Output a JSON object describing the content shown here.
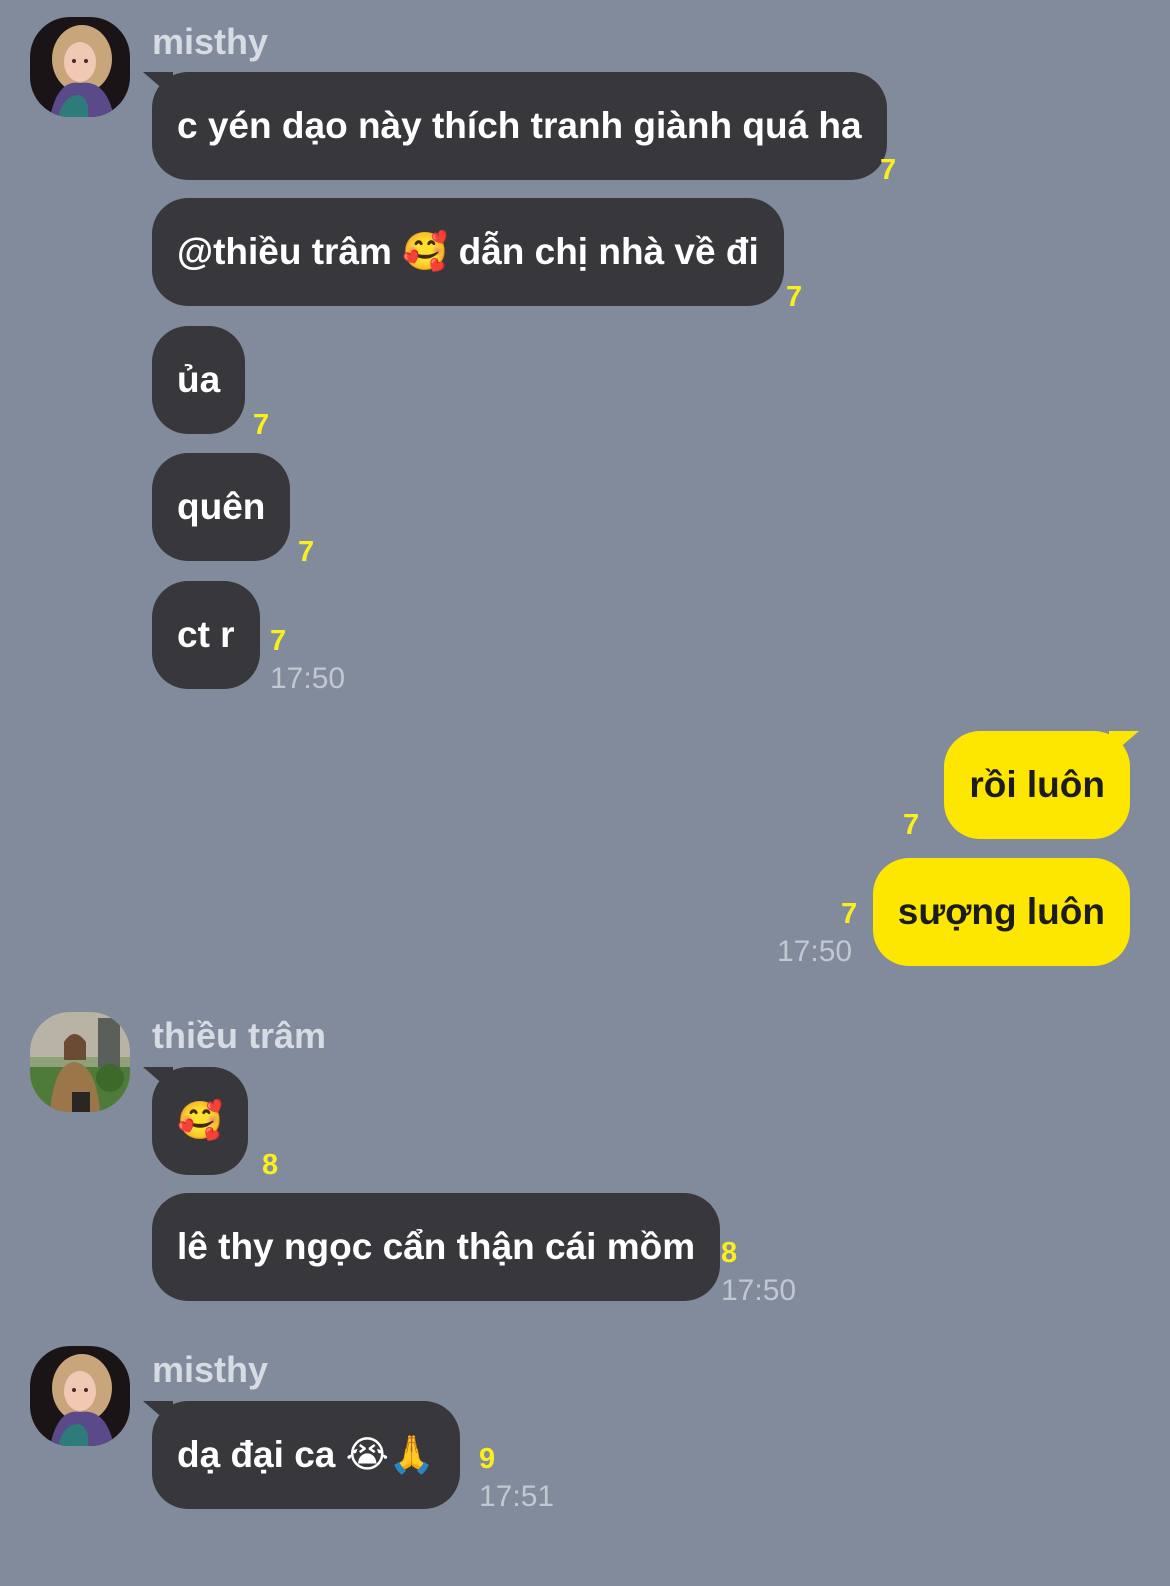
{
  "chat": {
    "groups": [
      {
        "sender": "misthy",
        "avatar_icon": "profile-photo-misthy",
        "messages": [
          {
            "text": "c yén dạo này thích tranh giành quá ha",
            "count": "7"
          },
          {
            "text": "@thiều trâm 🥰 dẫn chị nhà về đi",
            "count": "7"
          },
          {
            "text": "ủa",
            "count": "7"
          },
          {
            "text": "quên",
            "count": "7"
          },
          {
            "text": "ct r",
            "count": "7"
          }
        ],
        "time": "17:50"
      },
      {
        "sender": "me",
        "messages": [
          {
            "text": "rồi luôn",
            "count": "7"
          },
          {
            "text": "sượng luôn",
            "count": "7"
          }
        ],
        "time": "17:50"
      },
      {
        "sender": "thiều trâm",
        "avatar_icon": "profile-photo-thieu-tram",
        "messages": [
          {
            "text": "🥰",
            "count": "8"
          },
          {
            "text": "lê thy ngọc cẩn thận cái mồm",
            "count": "8"
          }
        ],
        "time": "17:50"
      },
      {
        "sender": "misthy",
        "avatar_icon": "profile-photo-misthy",
        "messages": [
          {
            "text": "dạ đại ca 😭🙏",
            "count": "9"
          }
        ],
        "time": "17:51"
      }
    ]
  },
  "colors": {
    "background": "#818b9b",
    "incoming_bubble": "#38383c",
    "outgoing_bubble": "#fde700",
    "unread_count": "#fbee20",
    "timestamp": "#c2c8d2"
  }
}
